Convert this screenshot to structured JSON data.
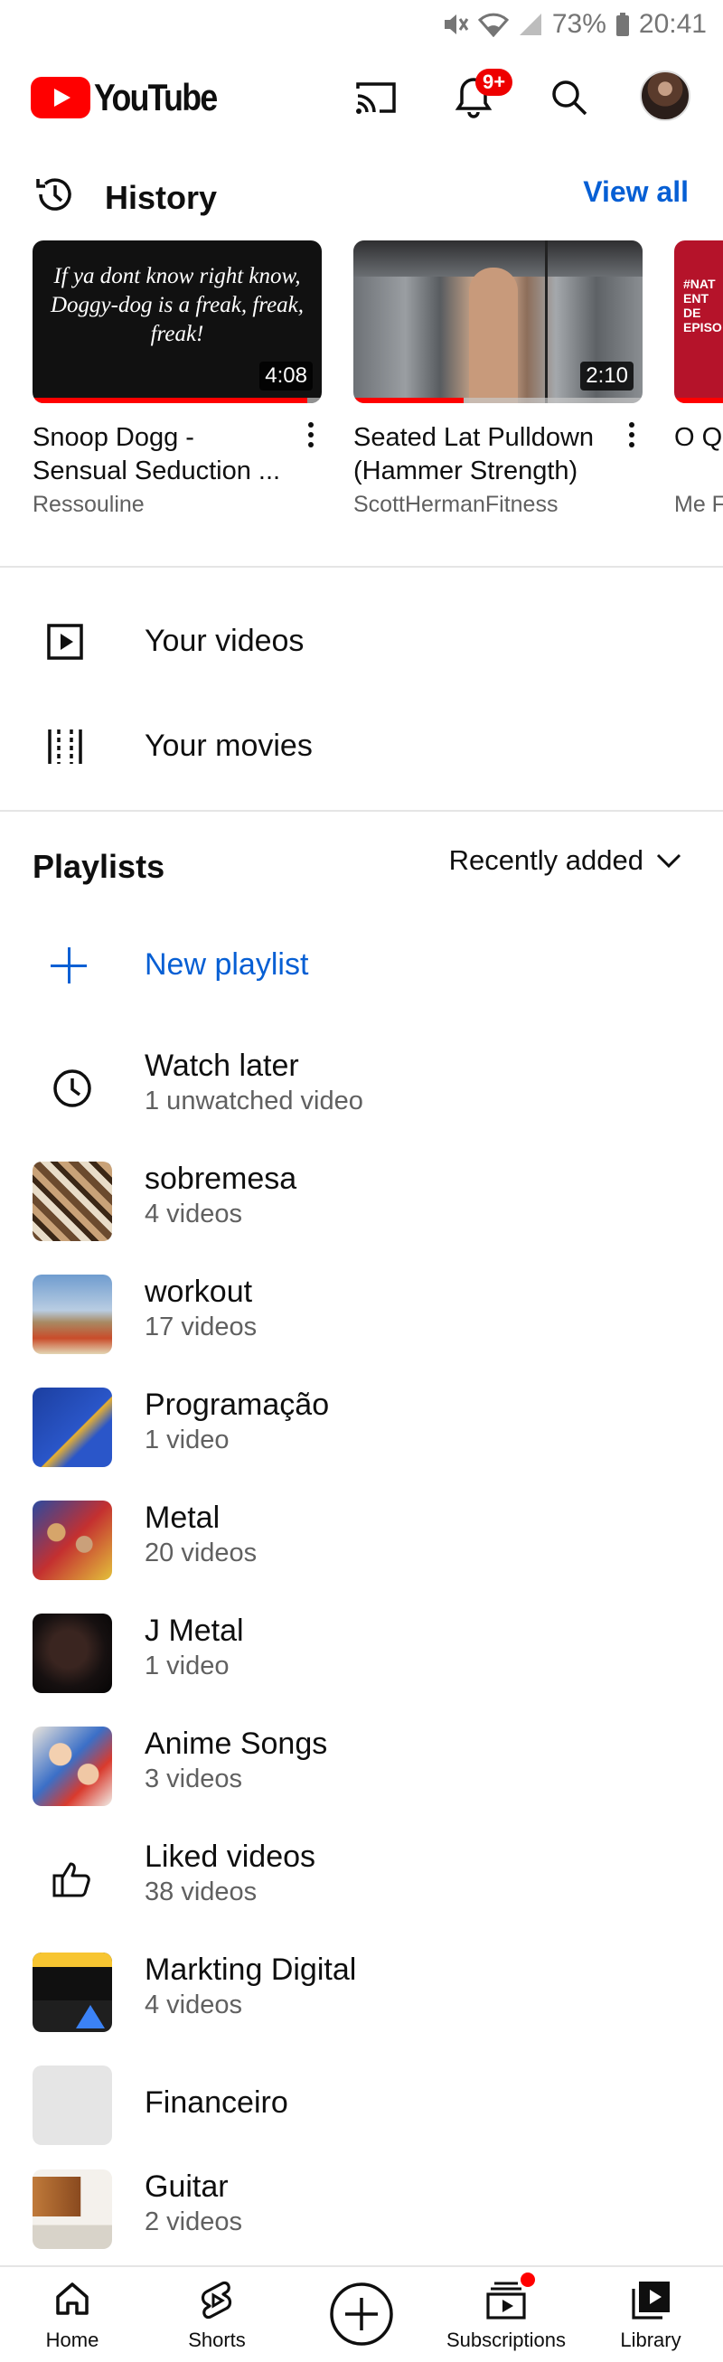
{
  "status_bar": {
    "battery": "73%",
    "time": "20:41"
  },
  "app_bar": {
    "logo_text": "YouTube",
    "notification_badge": "9+"
  },
  "history": {
    "title": "History",
    "view_all": "View all",
    "items": [
      {
        "title": "Snoop Dogg - Sensual Seduction ...",
        "channel": "Ressouline",
        "duration": "4:08",
        "progress": 0.95,
        "thumb_text": "If ya dont know right know, Doggy-dog is a freak, freak, freak!"
      },
      {
        "title": "Seated Lat Pulldown (Hammer Strength)",
        "channel": "ScottHermanFitness",
        "duration": "2:10",
        "progress": 0.38
      },
      {
        "title": "O QU NA I",
        "channel": "Me F",
        "thumb_text": "#NAT ENT DE EPISO"
      }
    ]
  },
  "library_menu": [
    {
      "label": "Your videos",
      "icon": "play-square-icon"
    },
    {
      "label": "Your movies",
      "icon": "film-strip-icon"
    }
  ],
  "playlists": {
    "title": "Playlists",
    "sort_label": "Recently added",
    "new_playlist": "New playlist",
    "items": [
      {
        "name": "Watch later",
        "count": "1 unwatched video",
        "thumb": "clock-icon"
      },
      {
        "name": "sobremesa",
        "count": "4 videos",
        "thumb": "photo"
      },
      {
        "name": "workout",
        "count": "17 videos",
        "thumb": "photo"
      },
      {
        "name": "Programação",
        "count": "1 video",
        "thumb": "photo"
      },
      {
        "name": "Metal",
        "count": "20 videos",
        "thumb": "photo"
      },
      {
        "name": "J Metal",
        "count": "1 video",
        "thumb": "photo"
      },
      {
        "name": "Anime Songs",
        "count": "3 videos",
        "thumb": "photo"
      },
      {
        "name": "Liked videos",
        "count": "38 videos",
        "thumb": "thumbs-up-icon"
      },
      {
        "name": "Markting Digital",
        "count": "4 videos",
        "thumb": "photo"
      },
      {
        "name": "Financeiro",
        "count": "",
        "thumb": "blank"
      },
      {
        "name": "Guitar",
        "count": "2 videos",
        "thumb": "photo"
      }
    ]
  },
  "bottom_nav": [
    {
      "label": "Home",
      "icon": "home-icon"
    },
    {
      "label": "Shorts",
      "icon": "shorts-icon"
    },
    {
      "label": "",
      "icon": "create-icon"
    },
    {
      "label": "Subscriptions",
      "icon": "subscriptions-icon"
    },
    {
      "label": "Library",
      "icon": "library-icon"
    }
  ],
  "colors": {
    "brand_red": "#ff0000",
    "link_blue": "#065fd4",
    "secondary_text": "#606060"
  }
}
